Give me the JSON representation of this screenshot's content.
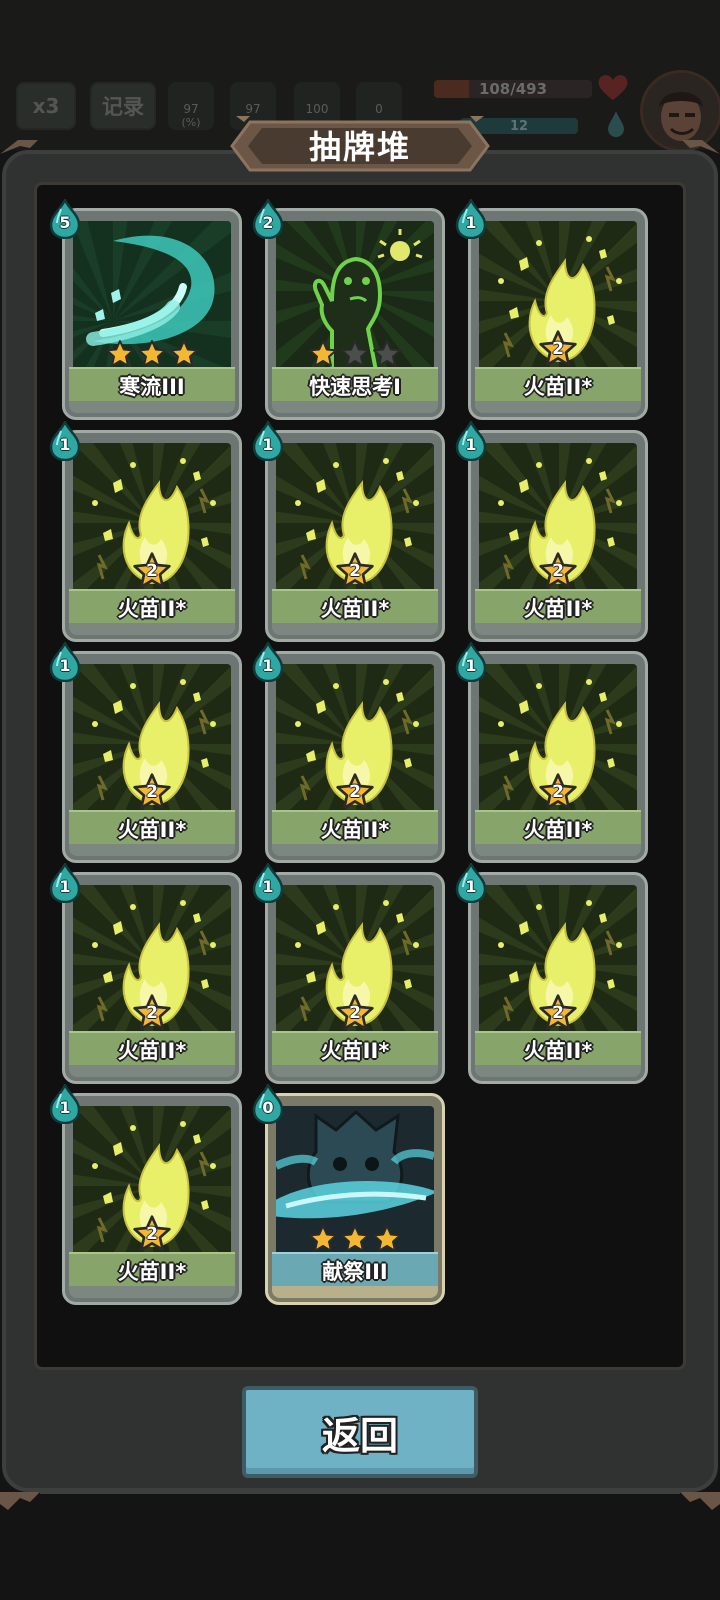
{
  "hud": {
    "speed_label": "x3",
    "record_label": "记录",
    "stats": [
      {
        "value": "97",
        "unit": "(%)"
      },
      {
        "value": "97",
        "unit": ""
      },
      {
        "value": "100",
        "unit": ""
      },
      {
        "value": "0",
        "unit": ""
      }
    ],
    "hp_text": "108/493",
    "hp_fraction": 0.22,
    "shield_text": "12"
  },
  "panel": {
    "title": "抽牌堆",
    "return_label": "返回"
  },
  "cards": [
    {
      "name": "寒流III",
      "cost": "5",
      "art": "cold",
      "stars_filled": 3,
      "stars_total": 3,
      "level": null,
      "style": "green"
    },
    {
      "name": "快速思考I",
      "cost": "2",
      "art": "think",
      "stars_filled": 1,
      "stars_total": 3,
      "level": null,
      "style": "green"
    },
    {
      "name": "火苗II*",
      "cost": "1",
      "art": "flame",
      "stars_filled": 0,
      "stars_total": 0,
      "level": "2",
      "style": "green"
    },
    {
      "name": "火苗II*",
      "cost": "1",
      "art": "flame",
      "stars_filled": 0,
      "stars_total": 0,
      "level": "2",
      "style": "green"
    },
    {
      "name": "火苗II*",
      "cost": "1",
      "art": "flame",
      "stars_filled": 0,
      "stars_total": 0,
      "level": "2",
      "style": "green"
    },
    {
      "name": "火苗II*",
      "cost": "1",
      "art": "flame",
      "stars_filled": 0,
      "stars_total": 0,
      "level": "2",
      "style": "green"
    },
    {
      "name": "火苗II*",
      "cost": "1",
      "art": "flame",
      "stars_filled": 0,
      "stars_total": 0,
      "level": "2",
      "style": "green"
    },
    {
      "name": "火苗II*",
      "cost": "1",
      "art": "flame",
      "stars_filled": 0,
      "stars_total": 0,
      "level": "2",
      "style": "green"
    },
    {
      "name": "火苗II*",
      "cost": "1",
      "art": "flame",
      "stars_filled": 0,
      "stars_total": 0,
      "level": "2",
      "style": "green"
    },
    {
      "name": "火苗II*",
      "cost": "1",
      "art": "flame",
      "stars_filled": 0,
      "stars_total": 0,
      "level": "2",
      "style": "green"
    },
    {
      "name": "火苗II*",
      "cost": "1",
      "art": "flame",
      "stars_filled": 0,
      "stars_total": 0,
      "level": "2",
      "style": "green"
    },
    {
      "name": "火苗II*",
      "cost": "1",
      "art": "flame",
      "stars_filled": 0,
      "stars_total": 0,
      "level": "2",
      "style": "green"
    },
    {
      "name": "火苗II*",
      "cost": "1",
      "art": "flame",
      "stars_filled": 0,
      "stars_total": 0,
      "level": "2",
      "style": "green"
    },
    {
      "name": "献祭III",
      "cost": "0",
      "art": "sacrifice",
      "stars_filled": 3,
      "stars_total": 3,
      "level": null,
      "style": "gold"
    }
  ],
  "colors": {
    "panel_bg": "#303231",
    "card_name_green": "#87a56a",
    "card_name_teal": "#6aa8b3",
    "cost_drop": "#2fa7a2",
    "flame": "#e8f06a",
    "star_gold": "#f4b731",
    "return_button": "#6fb2c6"
  }
}
